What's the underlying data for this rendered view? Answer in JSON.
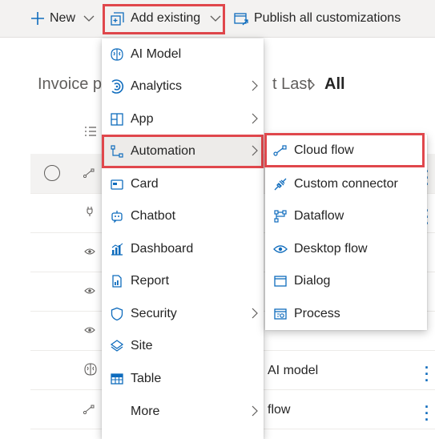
{
  "colors": {
    "accent": "#0f6cbd",
    "highlight": "#e0474c",
    "menu_selected": "#edebe9"
  },
  "command_bar": {
    "new_label": "New",
    "add_existing_label": "Add existing",
    "publish_label": "Publish all customizations"
  },
  "breadcrumb": {
    "prefix": "Invoice p",
    "middle": "t Last",
    "current": "All"
  },
  "background_rows": [
    {
      "icon": "flow-icon",
      "text": ""
    },
    {
      "icon": "plug-icon",
      "text": ""
    },
    {
      "icon": "eye-icon",
      "text": ""
    },
    {
      "icon": "eye-icon",
      "text": ""
    },
    {
      "icon": "eye-icon",
      "text": ""
    },
    {
      "icon": "ai-model-icon",
      "text": "AI model"
    },
    {
      "icon": "flow-icon",
      "text": "flow"
    }
  ],
  "add_existing_menu": {
    "items": [
      {
        "label": "AI Model",
        "icon": "ai-model-icon",
        "submenu": false
      },
      {
        "label": "Analytics",
        "icon": "analytics-icon",
        "submenu": true
      },
      {
        "label": "App",
        "icon": "app-icon",
        "submenu": true
      },
      {
        "label": "Automation",
        "icon": "automation-icon",
        "submenu": true,
        "selected": true
      },
      {
        "label": "Card",
        "icon": "card-icon",
        "submenu": false
      },
      {
        "label": "Chatbot",
        "icon": "chatbot-icon",
        "submenu": false
      },
      {
        "label": "Dashboard",
        "icon": "dashboard-icon",
        "submenu": false
      },
      {
        "label": "Report",
        "icon": "report-icon",
        "submenu": false
      },
      {
        "label": "Security",
        "icon": "security-icon",
        "submenu": true
      },
      {
        "label": "Site",
        "icon": "site-icon",
        "submenu": false
      },
      {
        "label": "Table",
        "icon": "table-icon",
        "submenu": false
      },
      {
        "label": "More",
        "icon": "",
        "submenu": true
      }
    ]
  },
  "automation_submenu": {
    "items": [
      {
        "label": "Cloud flow",
        "icon": "cloud-flow-icon"
      },
      {
        "label": "Custom connector",
        "icon": "custom-connector-icon"
      },
      {
        "label": "Dataflow",
        "icon": "dataflow-icon"
      },
      {
        "label": "Desktop flow",
        "icon": "desktop-flow-icon"
      },
      {
        "label": "Dialog",
        "icon": "dialog-icon"
      },
      {
        "label": "Process",
        "icon": "process-icon"
      }
    ]
  }
}
